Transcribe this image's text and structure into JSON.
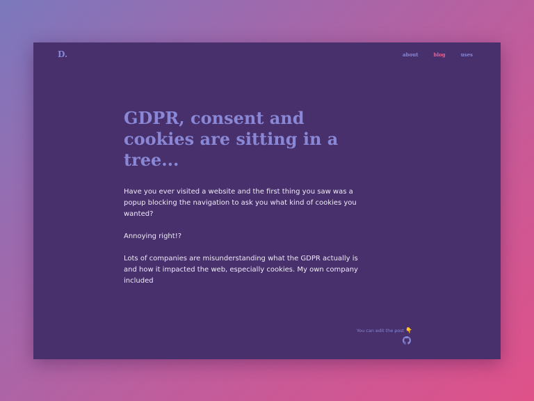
{
  "header": {
    "logo": "D.",
    "nav": [
      {
        "label": "about",
        "active": false
      },
      {
        "label": "blog",
        "active": true
      },
      {
        "label": "uses",
        "active": false
      }
    ]
  },
  "article": {
    "title": "GDPR, consent and cookies are sitting in a tree...",
    "paragraphs": [
      "Have you ever visited a website and the first thing you saw was a popup blocking the navigation to ask you what kind of cookies you wanted?",
      "Annoying right!?",
      "Lots of companies are misunderstanding what the GDPR actually is and how it impacted the web, especially cookies. My own company included"
    ]
  },
  "footer": {
    "edit_note": "You can edit the post",
    "pointing_hand": "👇",
    "github_icon": "github-icon"
  },
  "colors": {
    "card_background": "#47306b",
    "accent": "#8a88d6",
    "active_link": "#e8649b",
    "text": "#f0eaf8"
  }
}
